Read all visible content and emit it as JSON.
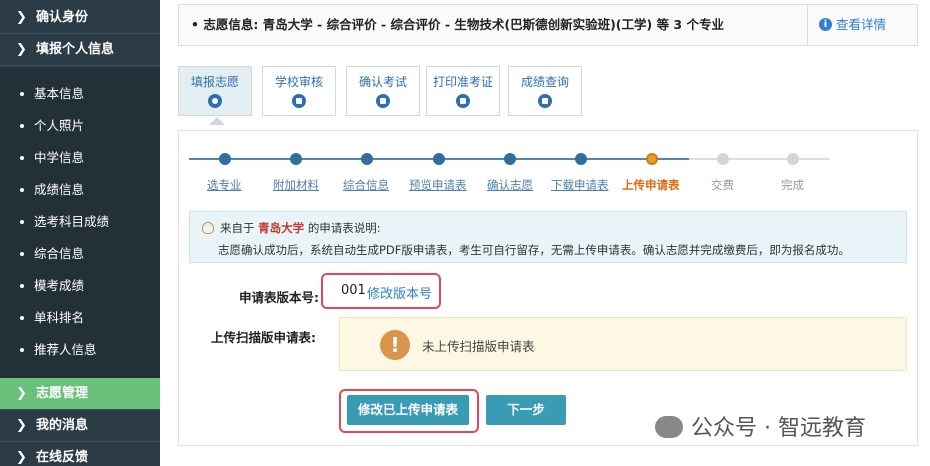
{
  "sidebar": {
    "top_items": [
      {
        "label": "确认身份"
      },
      {
        "label": "填报个人信息"
      }
    ],
    "sub_items": [
      {
        "label": "基本信息"
      },
      {
        "label": "个人照片"
      },
      {
        "label": "中学信息"
      },
      {
        "label": "成绩信息"
      },
      {
        "label": "选考科目成绩"
      },
      {
        "label": "综合信息"
      },
      {
        "label": "模考成绩"
      },
      {
        "label": "单科排名"
      },
      {
        "label": "推荐人信息"
      }
    ],
    "bottom_items": [
      {
        "label": "志愿管理",
        "active": true
      },
      {
        "label": "我的消息"
      },
      {
        "label": "在线反馈"
      }
    ],
    "active_color": "#6ac17a"
  },
  "notice": {
    "text": "志愿信息: 青岛大学 - 综合评价 - 综合评价 - 生物技术(巴斯德创新实验班)(工学) 等 3 个专业",
    "detail_link": "查看详情"
  },
  "tabs": [
    {
      "label": "填报志愿",
      "active": true
    },
    {
      "label": "学校审核"
    },
    {
      "label": "确认考试"
    },
    {
      "label": "打印准考证"
    },
    {
      "label": "成绩查询"
    }
  ],
  "steps": [
    {
      "label": "选专业",
      "state": "done"
    },
    {
      "label": "附加材料",
      "state": "done"
    },
    {
      "label": "综合信息",
      "state": "done"
    },
    {
      "label": "预览申请表",
      "state": "done"
    },
    {
      "label": "确认志愿",
      "state": "done"
    },
    {
      "label": "下载申请表",
      "state": "done"
    },
    {
      "label": "上传申请表",
      "state": "current"
    },
    {
      "label": "交费",
      "state": "todo"
    },
    {
      "label": "完成",
      "state": "todo"
    }
  ],
  "explain": {
    "prefix": "来自于",
    "school": "青岛大学",
    "suffix": "的申请表说明:",
    "body": "志愿确认成功后，系统自动生成PDF版申请表，考生可自行留存，无需上传申请表。确认志愿并完成缴费后，即为报名成功。"
  },
  "form": {
    "version_label": "申请表版本号:",
    "version_value": "001",
    "version_link": "修改版本号",
    "upload_label": "上传扫描版申请表:",
    "upload_status": "未上传扫描版申请表"
  },
  "buttons": {
    "modify": "修改已上传申请表",
    "next": "下一步"
  },
  "watermark": "公众号 · 智远教育"
}
